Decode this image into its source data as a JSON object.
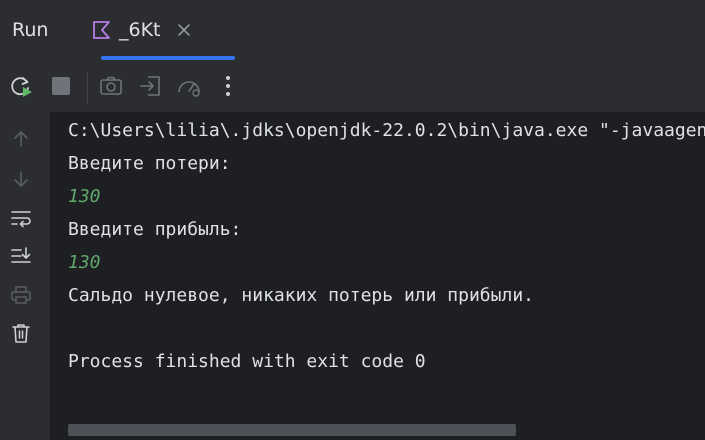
{
  "panel": {
    "title": "Run"
  },
  "tab": {
    "label": "_6Kt",
    "icon": "kotlin-icon"
  },
  "toolbar": {
    "buttons": [
      "rerun-icon",
      "stop-icon",
      "camera-icon",
      "restore-layout-icon",
      "attach-profiler-icon",
      "more-icon"
    ]
  },
  "gutter": {
    "buttons": [
      "arrow-up-icon",
      "arrow-down-icon",
      "soft-wrap-icon",
      "scroll-to-end-icon",
      "print-icon",
      "trash-icon"
    ]
  },
  "console": {
    "lines": [
      {
        "text": "C:\\Users\\lilia\\.jdks\\openjdk-22.0.2\\bin\\java.exe \"-javaagent",
        "kind": "output"
      },
      {
        "text": "Введите потери:",
        "kind": "output"
      },
      {
        "text": "130",
        "kind": "input"
      },
      {
        "text": "Введите прибыль:",
        "kind": "output"
      },
      {
        "text": "130",
        "kind": "input"
      },
      {
        "text": "Сальдо нулевое, никаких потерь или прибыли.",
        "kind": "output"
      },
      {
        "text": "",
        "kind": "output"
      },
      {
        "text": "Process finished with exit code 0",
        "kind": "output"
      }
    ]
  },
  "colors": {
    "background": "#1e1f22",
    "panel": "#2b2d30",
    "accent": "#3574f0",
    "input_text": "#5fa86a",
    "run_green": "#5fb865"
  }
}
